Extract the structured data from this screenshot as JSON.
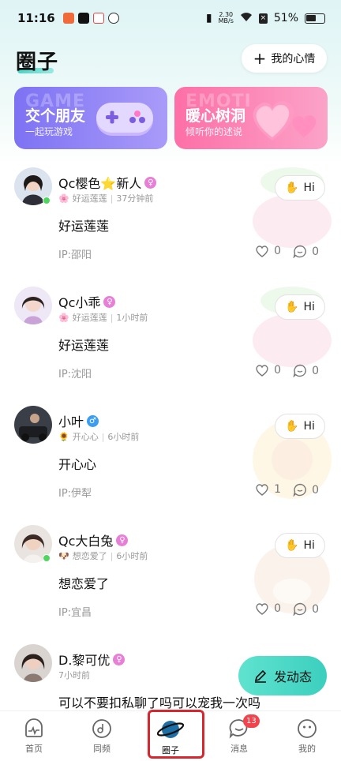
{
  "status_bar": {
    "time": "11:16",
    "net_speed_value": "2.30",
    "net_speed_unit": "MB/s",
    "battery": "51%"
  },
  "header": {
    "title": "圈子",
    "mood_button": "我的心情"
  },
  "banners": [
    {
      "watermark": "GAME",
      "title": "交个朋友",
      "subtitle": "一起玩游戏",
      "color": "#8e80f6"
    },
    {
      "watermark": "EMOTI",
      "title": "暖心树洞",
      "subtitle": "倾听你的述说",
      "color": "#fd7fb2"
    }
  ],
  "posts": [
    {
      "name": "Qc樱色⭐新人",
      "gender": "female",
      "gender_icon": "♀",
      "mood": "好运莲莲",
      "time": "37分钟前",
      "content": "好运莲莲",
      "ip": "IP:邵阳",
      "likes": "0",
      "comments": "0",
      "online": true
    },
    {
      "name": "Qc小乖",
      "gender": "female",
      "gender_icon": "♀",
      "mood": "好运莲莲",
      "time": "1小时前",
      "content": "好运莲莲",
      "ip": "IP:沈阳",
      "likes": "0",
      "comments": "0",
      "online": false
    },
    {
      "name": "小叶",
      "gender": "male",
      "gender_icon": "♂",
      "mood": "开心心",
      "time": "6小时前",
      "content": "开心心",
      "ip": "IP:伊犁",
      "likes": "1",
      "comments": "0",
      "online": false
    },
    {
      "name": "Qc大白兔",
      "gender": "female",
      "gender_icon": "♀",
      "mood": "想恋爱了",
      "time": "6小时前",
      "content": "想恋爱了",
      "ip": "IP:宜昌",
      "likes": "0",
      "comments": "0",
      "online": true
    },
    {
      "name": "D.黎可优",
      "gender": "female",
      "gender_icon": "♀",
      "mood": "",
      "time": "7小时前",
      "content": "可以不要扣私聊了吗可以宠我一次吗",
      "ip": "",
      "likes": "",
      "comments": "",
      "online": false
    }
  ],
  "hi_label": "Hi",
  "fab_label": "发动态",
  "tabs": [
    {
      "label": "首页",
      "icon": "pulse-icon"
    },
    {
      "label": "同频",
      "icon": "music-disc-icon"
    },
    {
      "label": "圈子",
      "icon": "planet-icon",
      "active": true
    },
    {
      "label": "消息",
      "icon": "chat-bubble-icon",
      "badge": "13"
    },
    {
      "label": "我的",
      "icon": "smiley-face-icon"
    }
  ],
  "colors": {
    "accent": "#3ccfbe",
    "badge": "#f2444c",
    "highlight": "#d7262e"
  }
}
